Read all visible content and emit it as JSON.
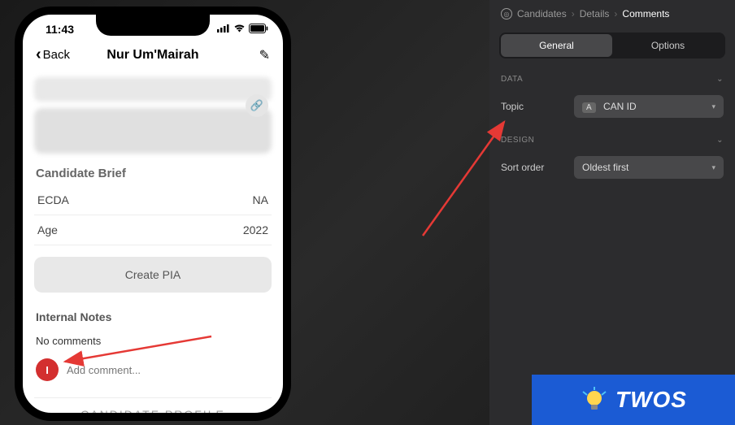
{
  "phone": {
    "status_time": "11:43",
    "back_label": "Back",
    "title": "Nur Um'Mairah",
    "section_brief_title": "Candidate Brief",
    "brief_rows": [
      {
        "label": "ECDA",
        "value": "NA"
      },
      {
        "label": "Age",
        "value": "2022"
      }
    ],
    "create_pia_label": "Create PIA",
    "internal_notes_title": "Internal Notes",
    "no_comments_text": "No comments",
    "avatar_initial": "I",
    "add_comment_placeholder": "Add comment...",
    "candidate_profile_label": "CANDIDATE PROFILE"
  },
  "panel": {
    "breadcrumb": {
      "root": "Candidates",
      "mid": "Details",
      "leaf": "Comments"
    },
    "tabs": {
      "general": "General",
      "options": "Options"
    },
    "sections": {
      "data_label": "DATA",
      "design_label": "DESIGN"
    },
    "fields": {
      "topic_label": "Topic",
      "topic_badge": "A",
      "topic_value": "CAN ID",
      "sort_label": "Sort order",
      "sort_value": "Oldest first"
    }
  },
  "watermark": {
    "text": "TWOS"
  }
}
